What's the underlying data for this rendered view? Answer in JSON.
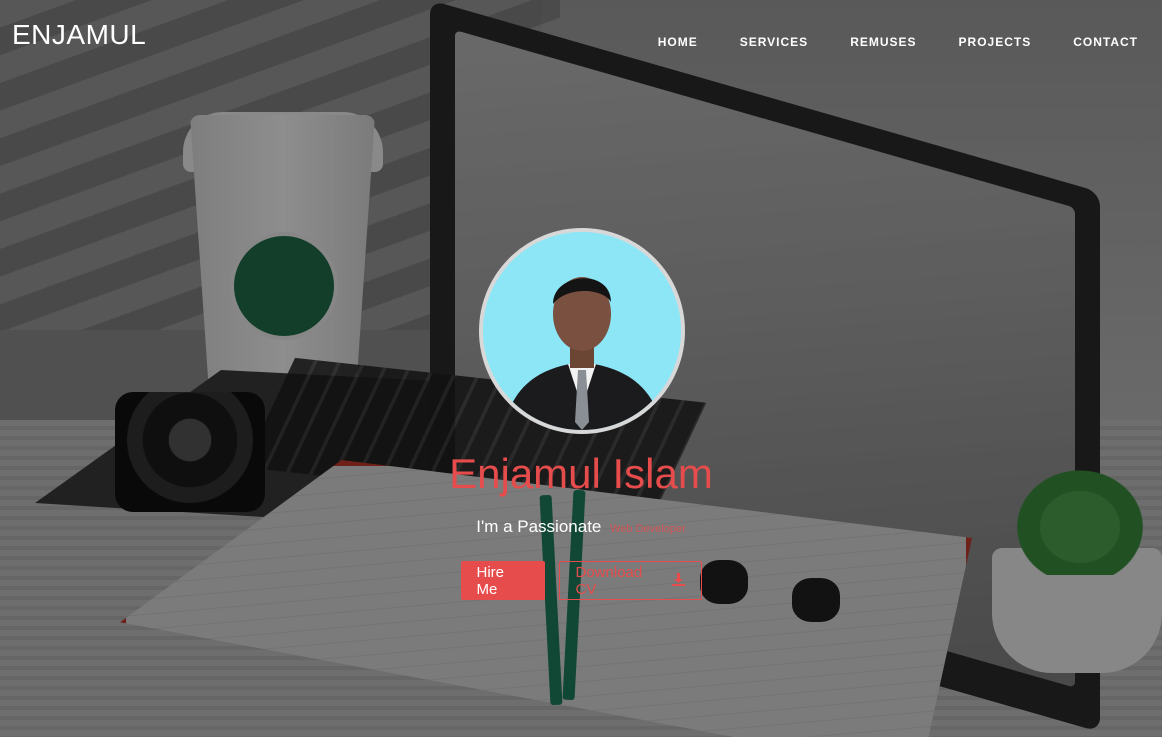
{
  "header": {
    "brand": "ENJAMUL",
    "nav": [
      "HOME",
      "SERVICES",
      "REMUSES",
      "PROJECTS",
      "CONTACT"
    ]
  },
  "hero": {
    "name": "Enjamul Islam",
    "tagline_prefix": "I'm a Passionate",
    "tagline_role": "Web Developer",
    "hire_label": "Hire Me",
    "download_label": "Download CV",
    "download_icon": "download-icon"
  },
  "colors": {
    "accent": "#e74c4c",
    "text": "#ffffff"
  }
}
